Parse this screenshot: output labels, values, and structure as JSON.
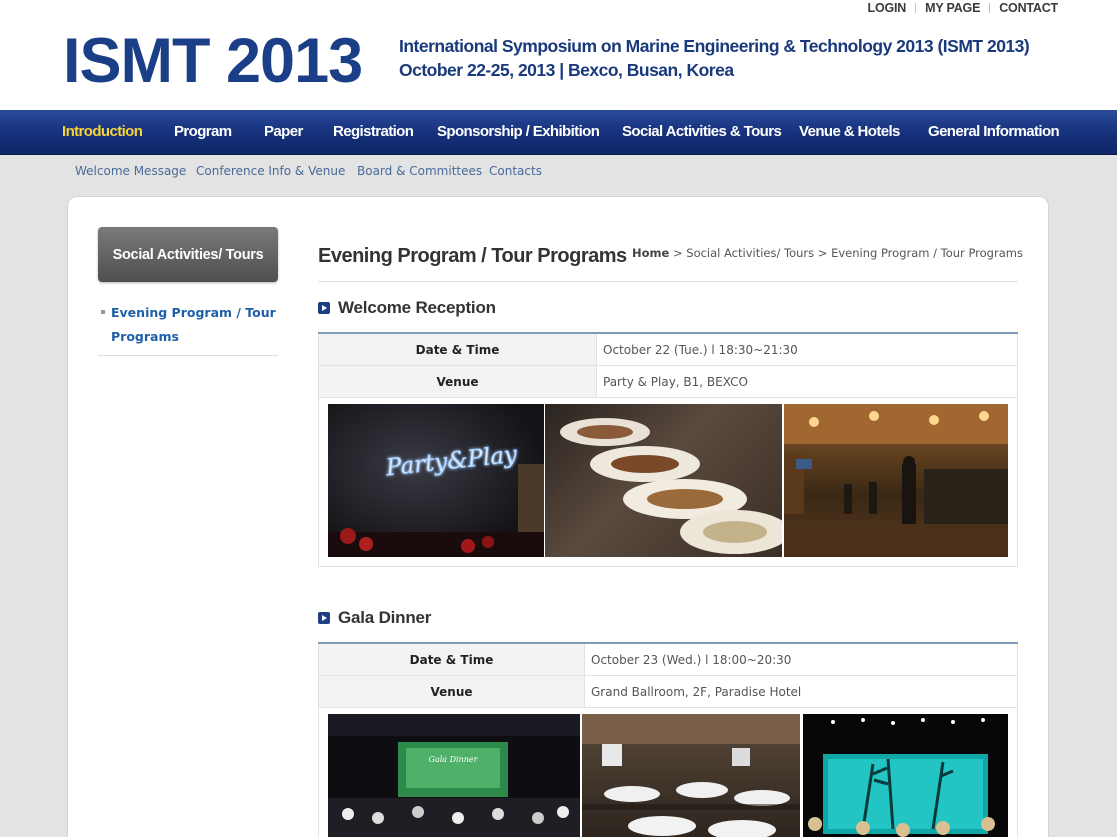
{
  "util": {
    "login": "LOGIN",
    "mypage": "MY PAGE",
    "contact": "CONTACT"
  },
  "logo": "ISMT 2013",
  "tagline": {
    "line1": "International Symposium on Marine Engineering & Technology 2013 (ISMT 2013)",
    "line2": "October 22-25, 2013 | Bexco, Busan, Korea"
  },
  "mainnav": [
    "Introduction",
    "Program",
    "Paper",
    "Registration",
    "Sponsorship / Exhibition",
    "Social Activities & Tours",
    "Venue & Hotels",
    "General Information"
  ],
  "subnav": [
    "Welcome Message",
    "Conference Info & Venue",
    "Board & Committees",
    "Contacts"
  ],
  "sidebar": {
    "title": "Social Activities/ Tours",
    "item": "Evening Program / Tour Programs"
  },
  "page": {
    "title": "Evening Program / Tour Programs"
  },
  "breadcrumb": {
    "home": "Home",
    "sep": ">",
    "c1": "Social Activities/ Tours",
    "c2": "Evening Program / Tour Programs"
  },
  "sections": [
    {
      "title": "Welcome Reception",
      "date_label": "Date & Time",
      "date_value": "October 22 (Tue.) l 18:30~21:30",
      "venue_label": "Venue",
      "venue_value": "Party & Play, B1, BEXCO",
      "neon": "Party&Play"
    },
    {
      "title": "Gala Dinner",
      "date_label": "Date & Time",
      "date_value": "October 23 (Wed.) l 18:00~20:30",
      "venue_label": "Venue",
      "venue_value": "Grand Ballroom, 2F, Paradise Hotel",
      "screen": "Gala Dinner"
    }
  ],
  "colors": {
    "nav_bg": "#15307a",
    "nav_active": "#f7d33a",
    "logo": "#1b3f86",
    "link": "#1f5fa8"
  }
}
